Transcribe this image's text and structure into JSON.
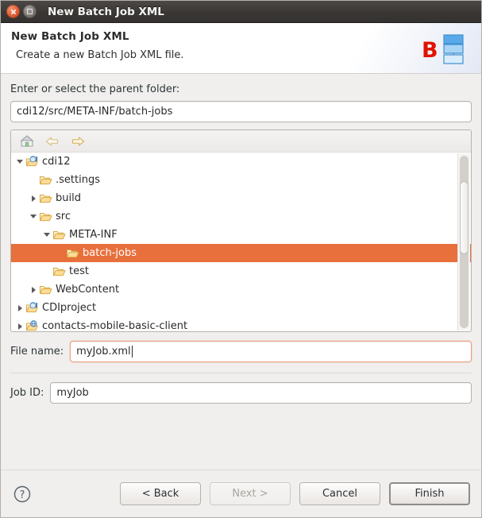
{
  "window": {
    "title": "New Batch Job XML",
    "close_icon": "close-icon",
    "maximize_icon": "maximize-icon"
  },
  "banner": {
    "title": "New Batch Job XML",
    "subtitle": "Create a new Batch Job XML file.",
    "icon": "batch-job-xml-banner-icon",
    "icon_letter": "B",
    "icon_letter_color": "#e11400",
    "icon_box_colors": [
      "#59a8e8",
      "#a8d4f5",
      "#d9ecfb"
    ],
    "icon_box_border": "#3f8fd0"
  },
  "parent_folder": {
    "label": "Enter or select the parent folder:",
    "value": "cdi12/src/META-INF/batch-jobs",
    "placeholder": ""
  },
  "tree_toolbar": {
    "home_label": "Home",
    "back_label": "Back",
    "forward_label": "Forward",
    "icons": [
      "home-icon",
      "back-arrow-icon",
      "forward-arrow-icon"
    ]
  },
  "tree": {
    "selection_color": "#e8703c",
    "rows": [
      {
        "label": "cdi12",
        "indent": 0,
        "twisty": "down",
        "icon": "java-project-icon",
        "selected": false
      },
      {
        "label": ".settings",
        "indent": 1,
        "twisty": "none",
        "icon": "folder-icon",
        "selected": false
      },
      {
        "label": "build",
        "indent": 1,
        "twisty": "right",
        "icon": "folder-icon",
        "selected": false
      },
      {
        "label": "src",
        "indent": 1,
        "twisty": "down",
        "icon": "folder-icon",
        "selected": false
      },
      {
        "label": "META-INF",
        "indent": 2,
        "twisty": "down",
        "icon": "folder-icon",
        "selected": false
      },
      {
        "label": "batch-jobs",
        "indent": 3,
        "twisty": "none",
        "icon": "folder-icon",
        "selected": true
      },
      {
        "label": "test",
        "indent": 2,
        "twisty": "none",
        "icon": "folder-icon",
        "selected": false
      },
      {
        "label": "WebContent",
        "indent": 1,
        "twisty": "right",
        "icon": "folder-icon",
        "selected": false
      },
      {
        "label": "CDIproject",
        "indent": 0,
        "twisty": "right",
        "icon": "java-project-icon",
        "selected": false
      },
      {
        "label": "contacts-mobile-basic-client",
        "indent": 0,
        "twisty": "right",
        "icon": "web-project-icon",
        "selected": false
      }
    ]
  },
  "file_name": {
    "label": "File name:",
    "value": "myJob.xml",
    "focused": true
  },
  "job_id": {
    "label": "Job ID:",
    "value": "myJob",
    "focused": false
  },
  "footer": {
    "help_icon": "help-icon",
    "buttons": [
      {
        "label": "< Back",
        "state": "enabled"
      },
      {
        "label": "Next >",
        "state": "disabled"
      },
      {
        "label": "Cancel",
        "state": "enabled"
      },
      {
        "label": "Finish",
        "state": "default"
      }
    ]
  }
}
